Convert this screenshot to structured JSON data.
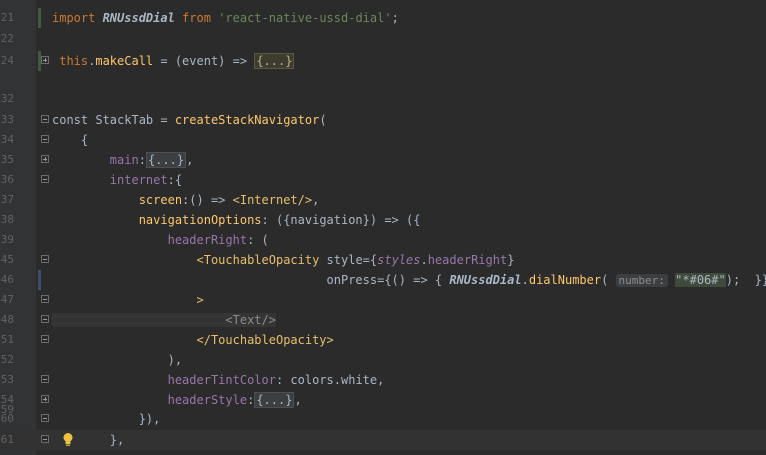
{
  "editor": {
    "lines": [
      {
        "num": "21",
        "segments": [
          [
            "kw",
            "import "
          ],
          [
            "cls",
            "RNUssdDial"
          ],
          [
            "kw",
            " from "
          ],
          [
            "str",
            "'react-native-ussd-dial'"
          ],
          [
            "plain",
            ";"
          ]
        ]
      },
      {
        "num": "22",
        "segments": []
      },
      {
        "num": "24",
        "segments": [
          [
            "kw",
            " this"
          ],
          [
            "plain",
            "."
          ],
          [
            "fn",
            "makeCall"
          ],
          [
            "plain",
            " = (event) => "
          ],
          [
            "folded",
            "{...}"
          ]
        ]
      },
      {
        "num": "32",
        "segments": []
      },
      {
        "num": "33",
        "segments": [
          [
            "plain",
            "const StackTab = "
          ],
          [
            "fn",
            "createStackNavigator"
          ],
          [
            "plain",
            "("
          ]
        ]
      },
      {
        "num": "34",
        "segments": [
          [
            "plain",
            "    {"
          ]
        ]
      },
      {
        "num": "35",
        "segments": [
          [
            "prop",
            "        main"
          ],
          [
            "plain",
            ":"
          ],
          [
            "folded",
            "{...}"
          ],
          [
            "plain",
            ","
          ]
        ]
      },
      {
        "num": "36",
        "segments": [
          [
            "prop",
            "        internet"
          ],
          [
            "plain",
            ":{"
          ]
        ]
      },
      {
        "num": "37",
        "segments": [
          [
            "fn",
            "            screen"
          ],
          [
            "plain",
            ":() => "
          ],
          [
            "tag",
            "<Internet/>"
          ],
          [
            "plain",
            ","
          ]
        ]
      },
      {
        "num": "38",
        "segments": [
          [
            "fn",
            "            navigationOptions"
          ],
          [
            "plain",
            ": ({navigation}) => ({"
          ]
        ]
      },
      {
        "num": "39",
        "segments": [
          [
            "prop",
            "                headerRight"
          ],
          [
            "plain",
            ": ("
          ]
        ]
      },
      {
        "num": "45",
        "segments": [
          [
            "tag",
            "                    <TouchableOpacity "
          ],
          [
            "plain",
            "style={"
          ],
          [
            "stylesitalic",
            "styles"
          ],
          [
            "plain",
            "."
          ],
          [
            "prop",
            "headerRight"
          ],
          [
            "plain",
            "}"
          ]
        ]
      },
      {
        "num": "46",
        "segments": [
          [
            "plain",
            "                                      onPress={() => { "
          ],
          [
            "cls",
            "RNUssdDial"
          ],
          [
            "plain",
            "."
          ],
          [
            "fn",
            "dialNumber"
          ],
          [
            "plain",
            "( "
          ],
          [
            "hint",
            "number:"
          ],
          [
            "plain",
            " "
          ],
          [
            "strbox",
            "\"*#06#\""
          ],
          [
            "plain",
            ");  }}"
          ]
        ]
      },
      {
        "num": "47",
        "segments": [
          [
            "tag",
            "                    >"
          ]
        ]
      },
      {
        "num": "48",
        "segments": [
          [
            "greytag",
            "                        <Text/>"
          ]
        ]
      },
      {
        "num": "51",
        "segments": [
          [
            "tag",
            "                    </TouchableOpacity>"
          ]
        ]
      },
      {
        "num": "52",
        "segments": [
          [
            "plain",
            "                ),"
          ]
        ]
      },
      {
        "num": "53",
        "segments": [
          [
            "prop",
            "                headerTintColor"
          ],
          [
            "plain",
            ": colors.white,"
          ]
        ]
      },
      {
        "num": "54",
        "segments": [
          [
            "prop",
            "                headerStyle"
          ],
          [
            "plain",
            ":"
          ],
          [
            "folded",
            "{...}"
          ],
          [
            "plain",
            ","
          ]
        ]
      },
      {
        "num": "59",
        "segments": []
      },
      {
        "num": "60",
        "segments": [
          [
            "plain",
            "            }),"
          ]
        ]
      },
      {
        "num": "61",
        "segments": [
          [
            "plain",
            "        },"
          ]
        ]
      }
    ]
  },
  "icons": {
    "intention_bulb": "lightbulb-icon",
    "fold": "fold-toggle-icon"
  },
  "colors": {
    "background": "#2b2b2b",
    "gutter": "#313335",
    "keyword": "#cc7832",
    "string": "#6a8759",
    "function": "#ffc66d",
    "property": "#9876aa",
    "tag": "#e8bf6a"
  }
}
